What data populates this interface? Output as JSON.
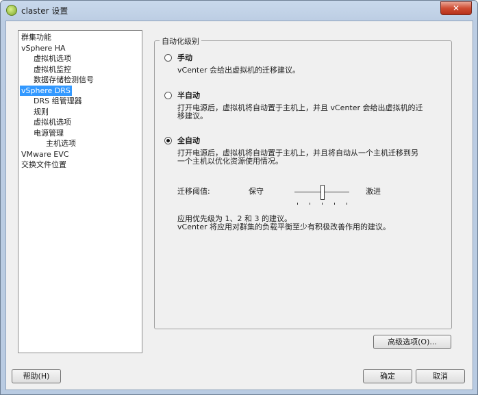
{
  "window": {
    "title": "claster 设置"
  },
  "tree": [
    {
      "label": "群集功能",
      "level": 0,
      "selected": false,
      "name": "tree-item-cluster-features"
    },
    {
      "label": "vSphere HA",
      "level": 0,
      "selected": false,
      "name": "tree-item-vsphere-ha"
    },
    {
      "label": "虚拟机选项",
      "level": 1,
      "selected": false,
      "name": "tree-item-ha-vm-options"
    },
    {
      "label": "虚拟机监控",
      "level": 1,
      "selected": false,
      "name": "tree-item-vm-monitoring"
    },
    {
      "label": "数据存储检测信号",
      "level": 1,
      "selected": false,
      "name": "tree-item-datastore-heartbeat"
    },
    {
      "label": "vSphere DRS",
      "level": 0,
      "selected": true,
      "name": "tree-item-vsphere-drs"
    },
    {
      "label": "DRS 组管理器",
      "level": 1,
      "selected": false,
      "name": "tree-item-drs-groups"
    },
    {
      "label": "规则",
      "level": 1,
      "selected": false,
      "name": "tree-item-rules"
    },
    {
      "label": "虚拟机选项",
      "level": 1,
      "selected": false,
      "name": "tree-item-drs-vm-options"
    },
    {
      "label": "电源管理",
      "level": 1,
      "selected": false,
      "name": "tree-item-power-management"
    },
    {
      "label": "主机选项",
      "level": 2,
      "selected": false,
      "name": "tree-item-host-options"
    },
    {
      "label": "VMware EVC",
      "level": 0,
      "selected": false,
      "name": "tree-item-vmware-evc"
    },
    {
      "label": "交换文件位置",
      "level": 0,
      "selected": false,
      "name": "tree-item-swapfile-location"
    }
  ],
  "automation": {
    "group_title": "自动化级别",
    "manual": {
      "label": "手动",
      "desc": "vCenter 会给出虚拟机的迁移建议。",
      "checked": false
    },
    "partial": {
      "label": "半自动",
      "desc1": "打开电源后，虚拟机将自动置于主机上，并且 vCenter 会给出虚拟机的迁",
      "desc2": "移建议。",
      "checked": false
    },
    "full": {
      "label": "全自动",
      "desc1": "打开电源后，虚拟机将自动置于主机上，并且将自动从一个主机迁移到另",
      "desc2": "一个主机以优化资源使用情况。",
      "checked": true
    }
  },
  "threshold": {
    "label": "迁移阈值:",
    "min_label": "保守",
    "max_label": "激进",
    "level": 3,
    "levels": 5,
    "note1": "应用优先级为 1、2 和 3 的建议。",
    "note2": "vCenter 将应用对群集的负载平衡至少有积极改善作用的建议。"
  },
  "buttons": {
    "advanced": "高级选项(O)...",
    "help": "帮助(H)",
    "ok": "确定",
    "cancel": "取消"
  },
  "icons": {
    "close": "✕"
  }
}
